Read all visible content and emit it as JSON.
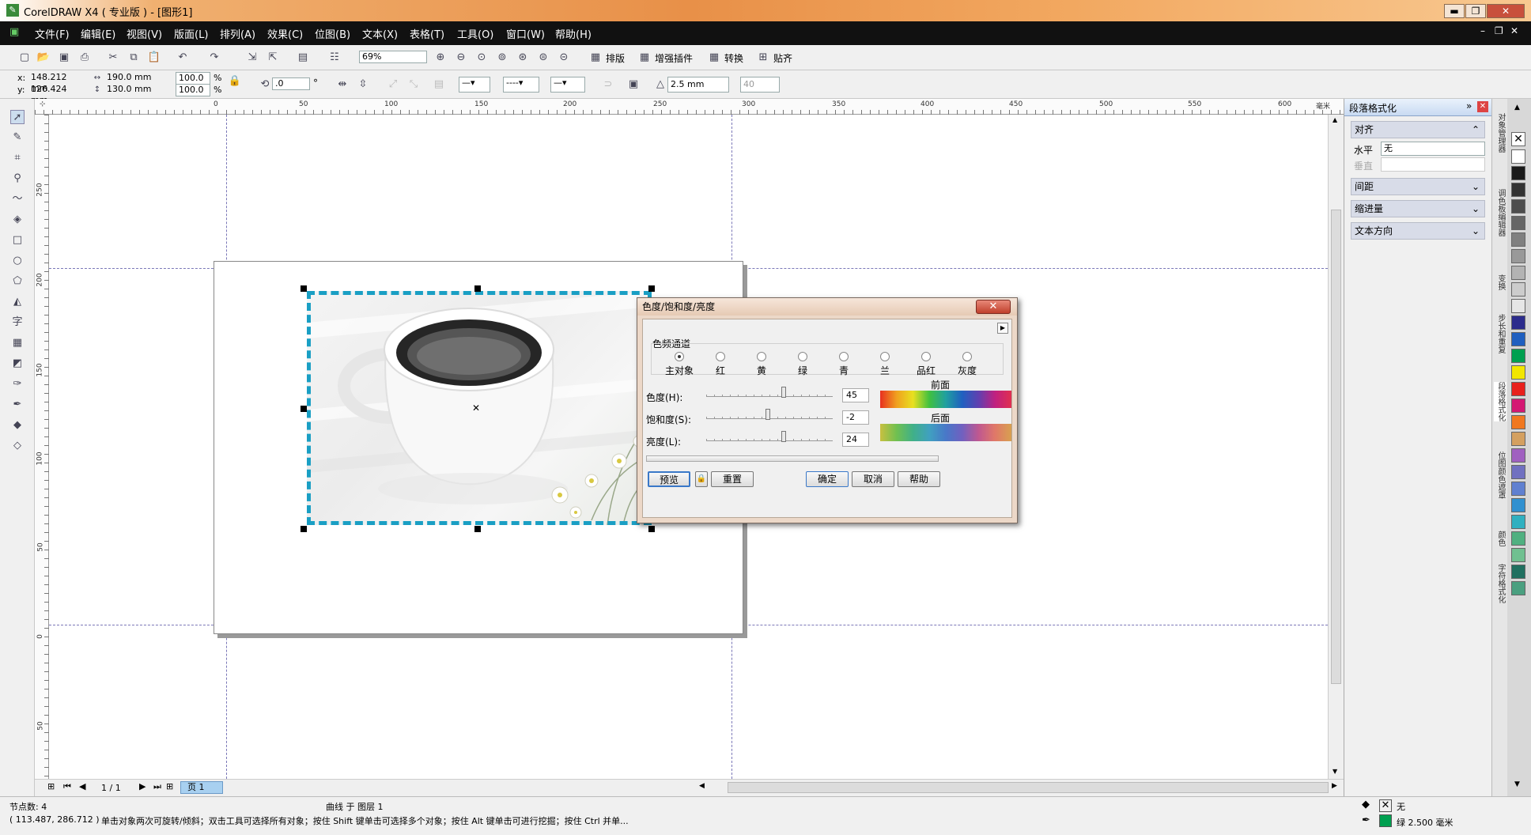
{
  "window": {
    "title": "CorelDRAW X4 ( 专业版 ) - [图形1]",
    "min": "▬",
    "max": "❐",
    "close": "✕"
  },
  "menu": [
    "文件(F)",
    "编辑(E)",
    "视图(V)",
    "版面(L)",
    "排列(A)",
    "效果(C)",
    "位图(B)",
    "文本(X)",
    "表格(T)",
    "工具(O)",
    "窗口(W)",
    "帮助(H)"
  ],
  "toolbar1": {
    "zoom": "69%",
    "layout_btn": "排版",
    "plugin_btn": "增强插件",
    "convert_btn": "转换",
    "snap_btn": "贴齐"
  },
  "toolbar2": {
    "x_label": "x:",
    "x_value": "148.212 mm",
    "y_label": "y:",
    "y_value": "126.424 mm",
    "w_value": "190.0 mm",
    "h_value": "130.0 mm",
    "sx_value": "100.0",
    "sy_value": "100.0",
    "pct": "%",
    "angle_value": ".0",
    "deg": "°",
    "outline_width": "2.5 mm",
    "corner_value": "40"
  },
  "ruler": {
    "h_ticks": [
      "0",
      "50",
      "100",
      "150",
      "200",
      "250",
      "300",
      "350",
      "400",
      "450",
      "500",
      "550",
      "600"
    ],
    "v_ticks": [
      "250",
      "200",
      "150",
      "100",
      "50",
      "0",
      "50"
    ],
    "unit": "毫米"
  },
  "dialog": {
    "title": "色度/饱和度/亮度",
    "close": "✕",
    "channel_group": "色频通道",
    "channels": [
      "主对象",
      "红",
      "黄",
      "绿",
      "青",
      "兰",
      "品红",
      "灰度"
    ],
    "hue_label": "色度(H):",
    "hue_value": "45",
    "hue_level": 0.62,
    "sat_label": "饱和度(S):",
    "sat_value": "-2",
    "sat_level": 0.49,
    "light_label": "亮度(L):",
    "light_value": "24",
    "light_level": 0.62,
    "before_label": "前面",
    "after_label": "后面",
    "preview_btn": "预览",
    "reset_btn": "重置",
    "ok_btn": "确定",
    "cancel_btn": "取消",
    "help_btn": "帮助"
  },
  "pagenav": {
    "count": "1 / 1",
    "page_tab": "页 1"
  },
  "docker": {
    "title": "段落格式化",
    "align_section": "对齐",
    "horizontal_label": "水平",
    "horizontal_value": "无",
    "vertical_label": "垂直",
    "spacing_section": "间距",
    "indent_section": "缩进量",
    "direction_section": "文本方向",
    "tabs": [
      "对象管理器",
      "调色板编辑器",
      "变换",
      "步长和重复",
      "段落格式化",
      "位图颜色遮罩",
      "颜色",
      "字符格式化"
    ]
  },
  "palette": [
    "#ffffff",
    "#1a1a1a",
    "#333333",
    "#4d4d4d",
    "#666666",
    "#808080",
    "#999999",
    "#b3b3b3",
    "#cccccc",
    "#e6e6e6",
    "#2c2c8c",
    "#1f5fbf",
    "#00a050",
    "#f2e600",
    "#e8201c",
    "#d41873",
    "#f07820",
    "#d4a060",
    "#a060c0",
    "#7070c0",
    "#6080d0",
    "#3090d0",
    "#30b0c0",
    "#50b080",
    "#70c090",
    "#207060",
    "#4aa080"
  ],
  "status": {
    "nodes": "节点数: 4",
    "object": "曲线 于 图层 1",
    "coords": "( 113.487, 286.712 )",
    "hint": "单击对象两次可旋转/倾斜；双击工具可选择所有对象；按住 Shift 键单击可选择多个对象；按住 Alt 键单击可进行挖掘；按住 Ctrl 并单...",
    "fill_label": "无",
    "outline_label": "绿 2.500 毫米",
    "fill_color": "#ffffff",
    "outline_color": "#00a050"
  }
}
